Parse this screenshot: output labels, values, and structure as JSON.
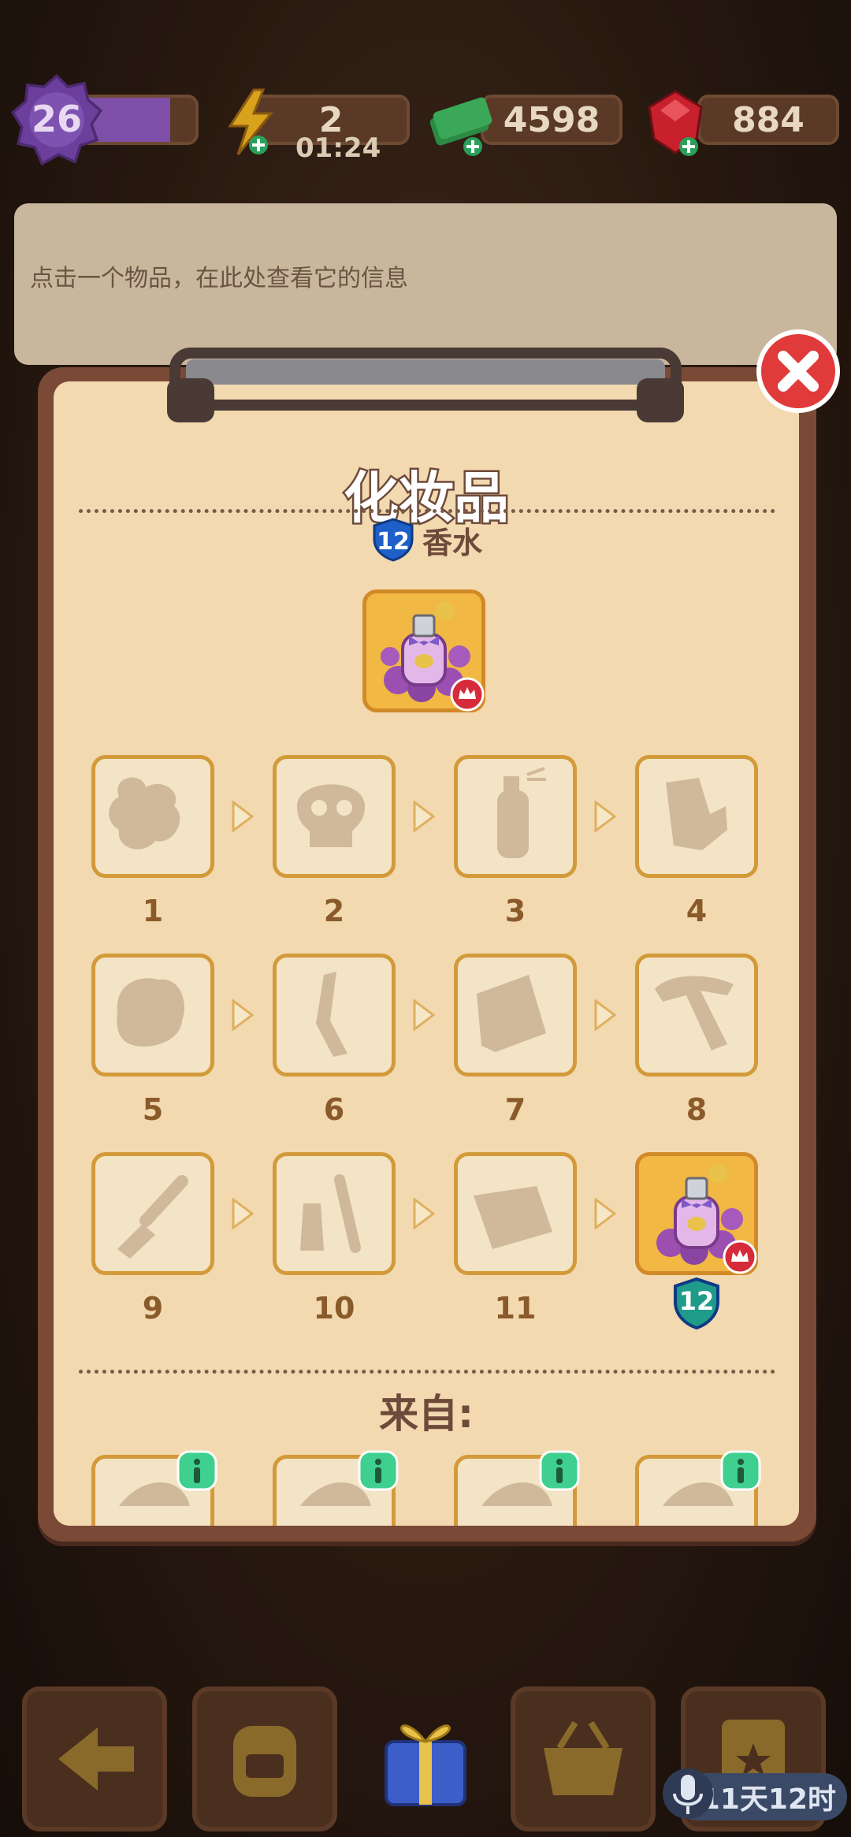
{
  "header": {
    "level": "26",
    "xp_progress": 0.78,
    "energy": "2",
    "energy_timer": "01:24",
    "cash": "4598",
    "gems": "884"
  },
  "info_panel": {
    "hint": "点击一个物品，在此处查看它的信息"
  },
  "modal": {
    "title": "化妆品",
    "item_level": "12",
    "item_name": "香水",
    "chain": [
      {
        "label": "1",
        "icon": "cloud-blob-icon"
      },
      {
        "label": "2",
        "icon": "skull-icon"
      },
      {
        "label": "3",
        "icon": "spray-bottle-icon"
      },
      {
        "label": "4",
        "icon": "lotion-tube-icon"
      },
      {
        "label": "5",
        "icon": "powder-puff-icon"
      },
      {
        "label": "6",
        "icon": "nail-file-icon"
      },
      {
        "label": "7",
        "icon": "palette-icon"
      },
      {
        "label": "8",
        "icon": "hair-tool-icon"
      },
      {
        "label": "9",
        "icon": "mascara-icon"
      },
      {
        "label": "10",
        "icon": "nail-polish-icon"
      },
      {
        "label": "11",
        "icon": "cosmetic-case-icon"
      },
      {
        "label": "12",
        "icon": "perfume-icon"
      }
    ],
    "from_label": "来自:"
  },
  "bottom": {
    "countdown": "11天12时"
  },
  "colors": {
    "paper": "#f2d9b0",
    "frame": "#7a4a37",
    "tile_border": "#d39a3a",
    "badge_blue": "#1f5fc8",
    "badge_teal": "#1f9b8a",
    "close_red": "#e03a3a",
    "info_green": "#3fcf8e"
  }
}
